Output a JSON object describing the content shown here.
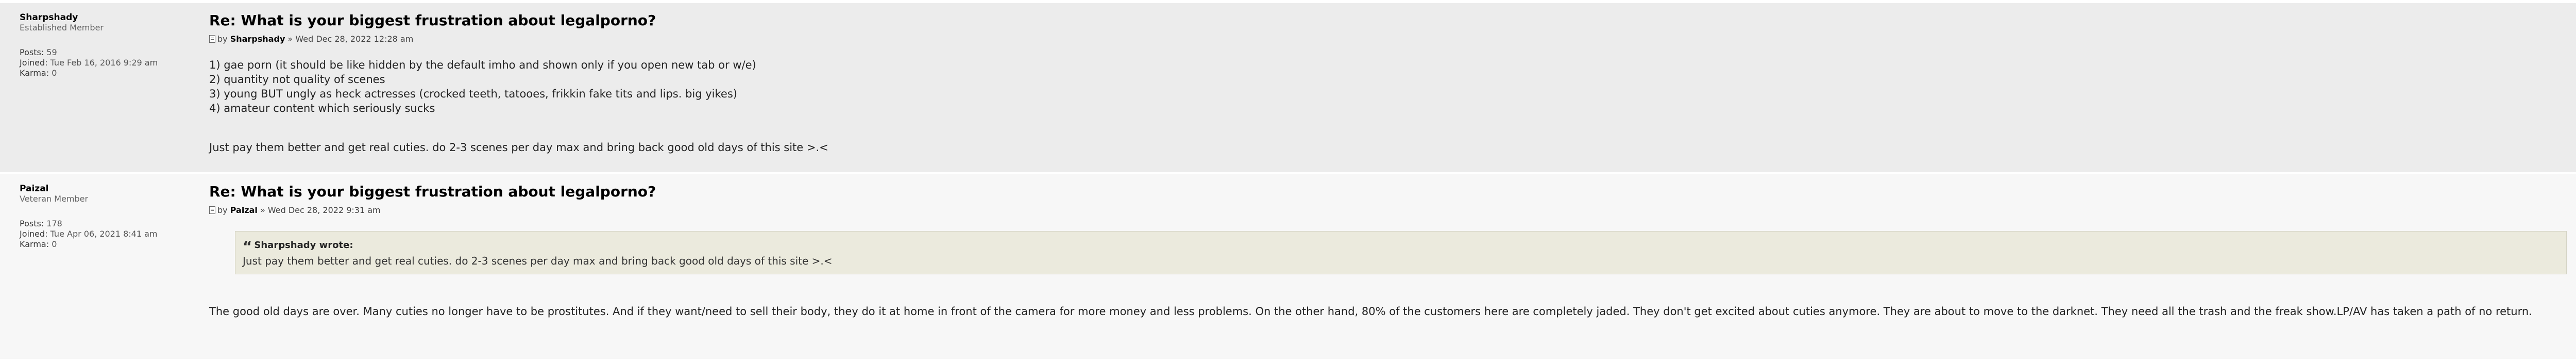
{
  "posts": [
    {
      "author": "Sharpshady",
      "rank": "Established Member",
      "posts_label": "Posts:",
      "posts_value": "59",
      "joined_label": "Joined:",
      "joined_value": "Tue Feb 16, 2016 9:29 am",
      "karma_label": "Karma:",
      "karma_value": "0",
      "title": "Re: What is your biggest frustration about legalporno?",
      "by": "by",
      "meta_author": "Sharpshady",
      "meta_date": "» Wed Dec 28, 2022 12:28 am",
      "lines": [
        "1) gae porn (it should be like hidden by the default imho and shown only if you open new tab or w/e)",
        "2) quantity not quality of scenes",
        "3) young BUT ungly as heck actresses (crocked teeth, tatooes, frikkin fake tits and lips. big yikes)",
        "4) amateur content which seriously sucks"
      ],
      "last_line": "Just pay them better and get real cuties. do 2-3 scenes per day max and bring back good old days of this site >.<"
    },
    {
      "author": "Paizal",
      "rank": "Veteran Member",
      "posts_label": "Posts:",
      "posts_value": "178",
      "joined_label": "Joined:",
      "joined_value": "Tue Apr 06, 2021 8:41 am",
      "karma_label": "Karma:",
      "karma_value": "0",
      "title": "Re: What is your biggest frustration about legalporno?",
      "by": "by",
      "meta_author": "Paizal",
      "meta_date": "» Wed Dec 28, 2022 9:31 am",
      "quote_mark": "“",
      "quote_author": "Sharpshady wrote:",
      "quote_text": "Just pay them better and get real cuties. do 2-3 scenes per day max and bring back good old days of this site >.<",
      "body": "The good old days are over. Many cuties no longer have to be prostitutes. And if they want/need to sell their body, they do it at home in front of the camera for more money and less problems. On the other hand, 80% of the customers here are completely jaded. They don't get excited about cuties anymore. They are about to move to the darknet. They need all the trash and the freak show.LP/AV has taken a path of no return."
    }
  ],
  "icons": {
    "post_icon": "post-document-icon",
    "top_icon": "back-to-top-icon"
  }
}
